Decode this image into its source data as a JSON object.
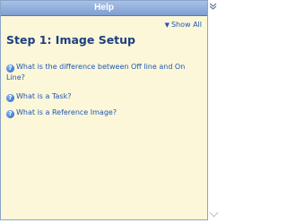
{
  "window": {
    "title": "Help"
  },
  "toolbar": {
    "show_all_label": "Show All",
    "show_all_icon": "triangle-down"
  },
  "main": {
    "heading": "Step 1: Image Setup",
    "links": [
      {
        "label": "What is the difference between Off line and On Line?",
        "icon": "help-icon"
      },
      {
        "label": "What is a Task?",
        "icon": "help-icon"
      },
      {
        "label": "What is a Reference Image?",
        "icon": "help-icon"
      }
    ]
  },
  "colors": {
    "title_bar": "#7f9fd3",
    "background": "#fbf7d8",
    "link": "#1f57b5",
    "heading": "#1f3f7f"
  }
}
